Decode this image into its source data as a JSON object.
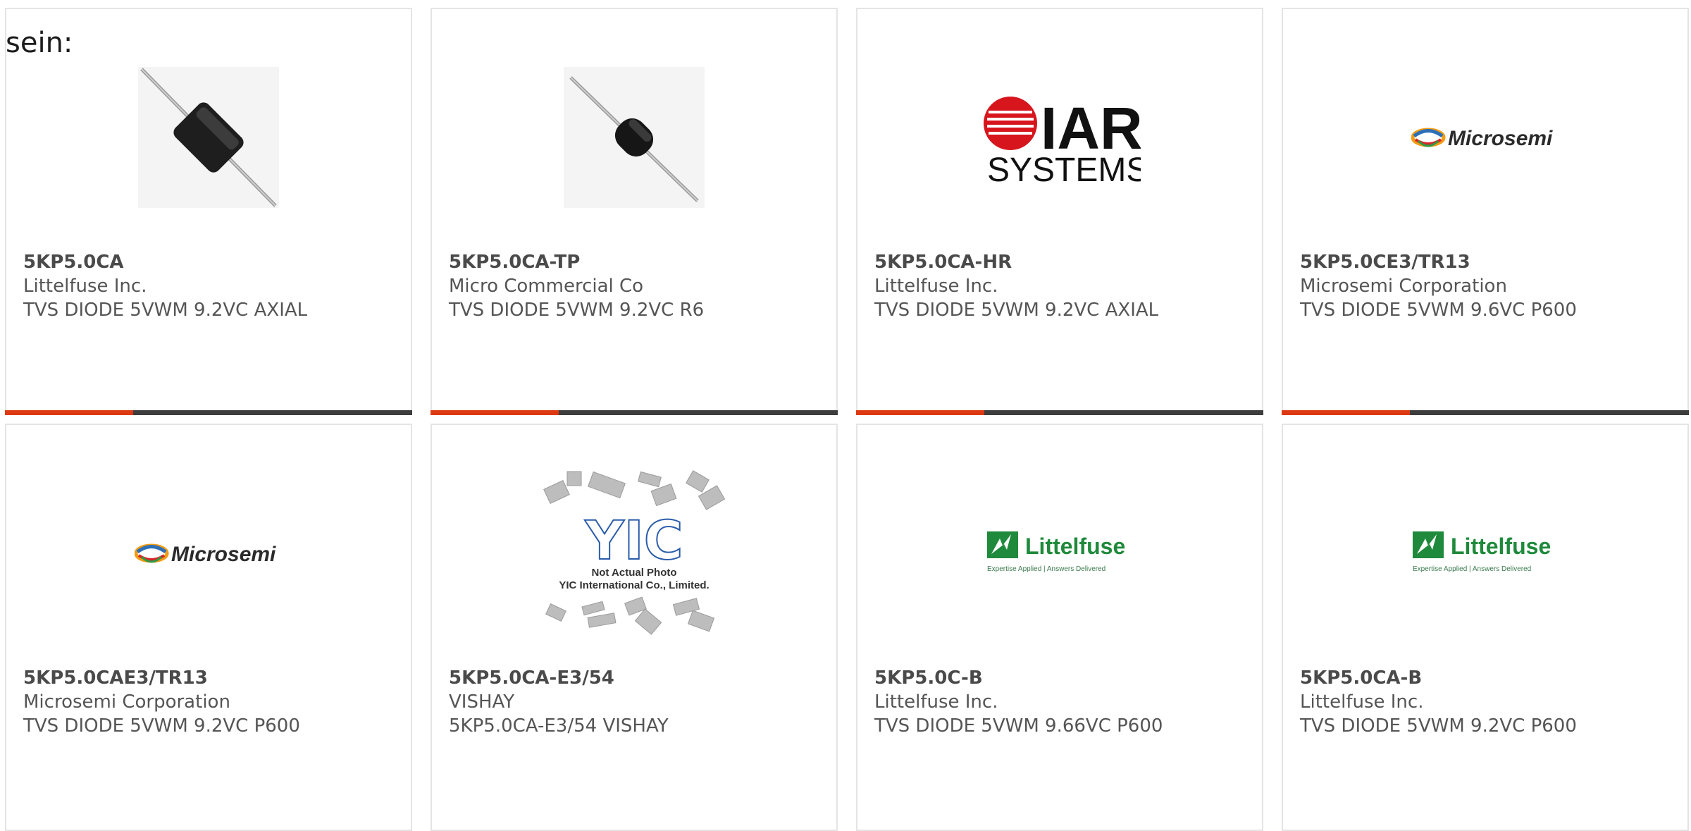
{
  "intro_text": "sein:",
  "accent_color": "#dd3a14",
  "bar_color": "#3d3d3d",
  "cards": [
    {
      "part": "5KP5.0CA",
      "manufacturer": "Littelfuse Inc.",
      "description": "TVS DIODE 5VWM 9.2VC AXIAL",
      "image": "axial-diode-photo"
    },
    {
      "part": "5KP5.0CA-TP",
      "manufacturer": "Micro Commercial Co",
      "description": "TVS DIODE 5VWM 9.2VC R6",
      "image": "axial-diode-photo"
    },
    {
      "part": "5KP5.0CA-HR",
      "manufacturer": "Littelfuse Inc.",
      "description": "TVS DIODE 5VWM 9.2VC AXIAL",
      "image": "iar-systems-logo",
      "logo_text": [
        "IAR",
        "SYSTEMS"
      ]
    },
    {
      "part": "5KP5.0CE3/TR13",
      "manufacturer": "Microsemi Corporation",
      "description": "TVS DIODE 5VWM 9.6VC P600",
      "image": "microsemi-logo",
      "logo_text": [
        "Microsemi"
      ]
    },
    {
      "part": "5KP5.0CAE3/TR13",
      "manufacturer": "Microsemi Corporation",
      "description": "TVS DIODE 5VWM 9.2VC P600",
      "image": "microsemi-logo",
      "logo_text": [
        "Microsemi"
      ]
    },
    {
      "part": "5KP5.0CA-E3/54",
      "manufacturer": "VISHAY",
      "description": "5KP5.0CA-E3/54 VISHAY",
      "image": "not-actual-photo-placeholder",
      "logo_text": [
        "YIC",
        "Not Actual Photo",
        "YIC International Co., Limited."
      ]
    },
    {
      "part": "5KP5.0C-B",
      "manufacturer": "Littelfuse Inc.",
      "description": "TVS DIODE 5VWM 9.66VC P600",
      "image": "littelfuse-logo",
      "logo_text": [
        "Littelfuse",
        "Expertise Applied | Answers Delivered"
      ]
    },
    {
      "part": "5KP5.0CA-B",
      "manufacturer": "Littelfuse Inc.",
      "description": "TVS DIODE 5VWM 9.2VC P600",
      "image": "littelfuse-logo",
      "logo_text": [
        "Littelfuse",
        "Expertise Applied | Answers Delivered"
      ]
    }
  ]
}
